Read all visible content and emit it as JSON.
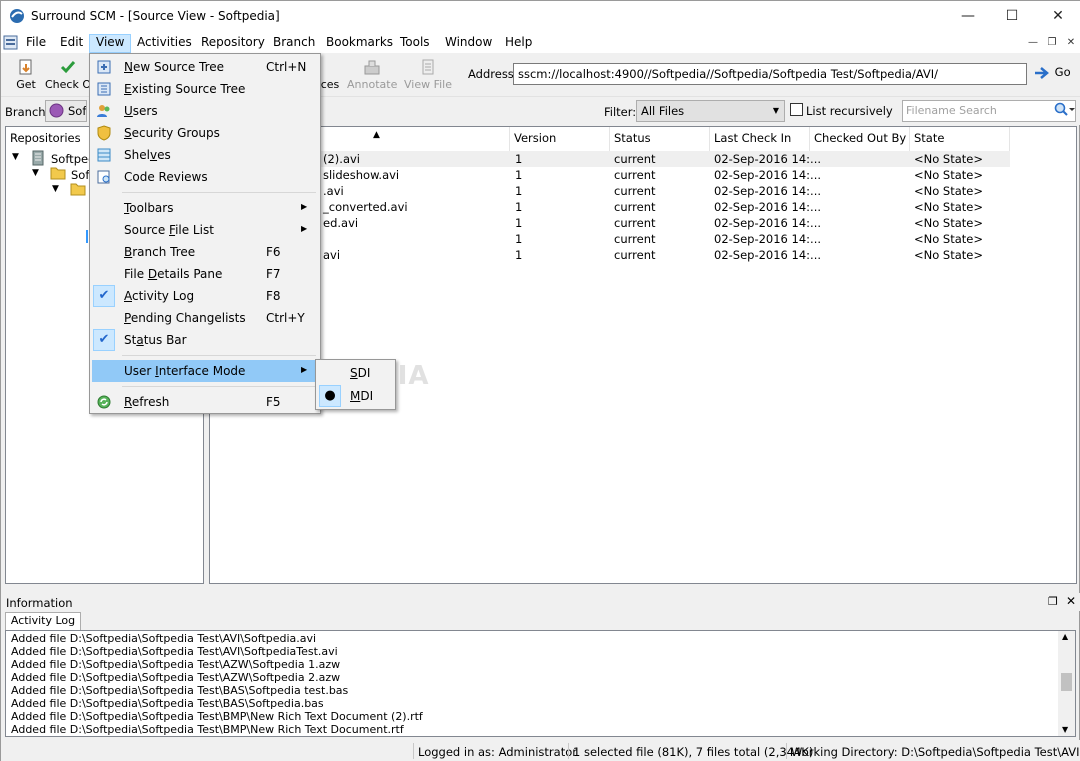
{
  "window": {
    "title": "Surround SCM - [Source View - Softpedia]",
    "controls": {
      "minimize": "—",
      "maximize": "☐",
      "close": "✕"
    }
  },
  "menubar": {
    "items": [
      "File",
      "Edit",
      "View",
      "Activities",
      "Repository",
      "Branch",
      "Bookmarks",
      "Tools",
      "Window",
      "Help"
    ],
    "active": "View"
  },
  "toolbar": {
    "buttons": [
      {
        "label": "Get",
        "icon": "get-icon"
      },
      {
        "label": "Check O",
        "icon": "check-out-icon"
      },
      {
        "label": "ces",
        "icon": "differences-icon"
      },
      {
        "label": "Annotate",
        "icon": "annotate-icon",
        "disabled": true
      },
      {
        "label": "View File",
        "icon": "view-file-icon",
        "disabled": true
      }
    ],
    "address_label": "Address:",
    "address_value": "sscm://localhost:4900//Softpedia//Softpedia/Softpedia Test/Softpedia/AVI/",
    "go_label": "Go"
  },
  "filterbar": {
    "branch_label": "Branch:",
    "branch_value": "Soft",
    "filter_label": "Filter:",
    "filter_value": "All Files",
    "recursive_label": "List recursively",
    "search_placeholder": "Filename Search"
  },
  "repo_pane": {
    "title": "Repositories",
    "nodes": [
      "Softped",
      "Sof"
    ]
  },
  "file_list": {
    "columns": [
      "Version",
      "Status",
      "Last Check In",
      "Checked Out By",
      "State"
    ],
    "rows": [
      {
        "name": "(2).avi",
        "version": "1",
        "status": "current",
        "last": "02-Sep-2016 14:...",
        "by": "",
        "state": "<No State>"
      },
      {
        "name": "slideshow.avi",
        "version": "1",
        "status": "current",
        "last": "02-Sep-2016 14:...",
        "by": "",
        "state": "<No State>"
      },
      {
        "name": ".avi",
        "version": "1",
        "status": "current",
        "last": "02-Sep-2016 14:...",
        "by": "",
        "state": "<No State>"
      },
      {
        "name": "_converted.avi",
        "version": "1",
        "status": "current",
        "last": "02-Sep-2016 14:...",
        "by": "",
        "state": "<No State>"
      },
      {
        "name": "ed.avi",
        "version": "1",
        "status": "current",
        "last": "02-Sep-2016 14:...",
        "by": "",
        "state": "<No State>"
      },
      {
        "name": "",
        "version": "1",
        "status": "current",
        "last": "02-Sep-2016 14:...",
        "by": "",
        "state": "<No State>"
      },
      {
        "name": "avi",
        "version": "1",
        "status": "current",
        "last": "02-Sep-2016 14:...",
        "by": "",
        "state": "<No State>"
      }
    ]
  },
  "view_menu": {
    "items": [
      {
        "label": "New Source Tree",
        "shortcut": "Ctrl+N",
        "icon": "new-source-tree-icon"
      },
      {
        "label": "Existing Source Tree",
        "shortcut": "",
        "icon": "existing-source-tree-icon"
      },
      {
        "label": "Users",
        "shortcut": "",
        "icon": "users-icon"
      },
      {
        "label": "Security Groups",
        "shortcut": "",
        "icon": "security-groups-icon"
      },
      {
        "label": "Shelves",
        "shortcut": "",
        "icon": "shelves-icon"
      },
      {
        "label": "Code Reviews",
        "shortcut": "",
        "icon": "code-reviews-icon"
      },
      {
        "label": "Toolbars",
        "shortcut": "",
        "submenu": true
      },
      {
        "label": "Source File List",
        "shortcut": "",
        "submenu": true
      },
      {
        "label": "Branch Tree",
        "shortcut": "F6"
      },
      {
        "label": "File Details Pane",
        "shortcut": "F7"
      },
      {
        "label": "Activity Log",
        "shortcut": "F8",
        "checked": true
      },
      {
        "label": "Pending Changelists",
        "shortcut": "Ctrl+Y"
      },
      {
        "label": "Status Bar",
        "shortcut": "",
        "checked": true
      },
      {
        "label": "User Interface Mode",
        "shortcut": "",
        "submenu": true,
        "highlighted": true
      },
      {
        "label": "Refresh",
        "shortcut": "F5",
        "icon": "refresh-icon"
      }
    ],
    "submenu": [
      {
        "label": "SDI",
        "selected": false
      },
      {
        "label": "MDI",
        "selected": true
      }
    ]
  },
  "info": {
    "title": "Information",
    "tab": "Activity Log",
    "log": [
      "Added file D:\\Softpedia\\Softpedia Test\\AVI\\Softpedia.avi",
      "Added file D:\\Softpedia\\Softpedia Test\\AVI\\SoftpediaTest.avi",
      "Added file D:\\Softpedia\\Softpedia Test\\AZW\\Softpedia 1.azw",
      "Added file D:\\Softpedia\\Softpedia Test\\AZW\\Softpedia 2.azw",
      "Added file D:\\Softpedia\\Softpedia Test\\BAS\\Softpedia test.bas",
      "Added file D:\\Softpedia\\Softpedia Test\\BAS\\Softpedia.bas",
      "Added file D:\\Softpedia\\Softpedia Test\\BMP\\New Rich Text Document (2).rtf",
      "Added file D:\\Softpedia\\Softpedia Test\\BMP\\New Rich Text Document.rtf"
    ]
  },
  "statusbar": {
    "logged_in": "Logged in as: Administrator",
    "selection": "1 selected file (81K), 7 files total (2,344K)",
    "working_dir": "Working Directory: D:\\Softpedia\\Softpedia Test\\AVI"
  },
  "watermark": "SOFTPEDIA"
}
